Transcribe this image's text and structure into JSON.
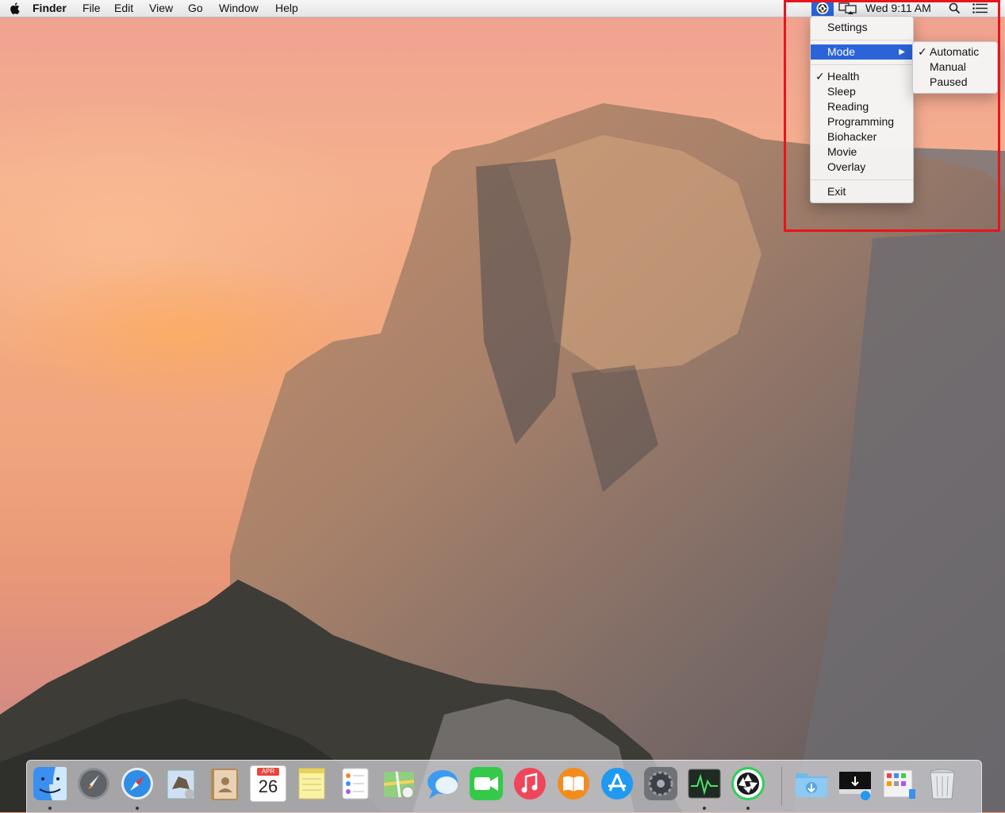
{
  "menubar": {
    "app_name": "Finder",
    "menus": [
      "File",
      "Edit",
      "View",
      "Go",
      "Window",
      "Help"
    ],
    "clock": "Wed 9:11 AM"
  },
  "app_menu": {
    "settings": "Settings",
    "mode": "Mode",
    "presets": [
      "Health",
      "Sleep",
      "Reading",
      "Programming",
      "Biohacker",
      "Movie",
      "Overlay"
    ],
    "checked_preset": "Health",
    "exit": "Exit"
  },
  "mode_submenu": {
    "options": [
      "Automatic",
      "Manual",
      "Paused"
    ],
    "checked_option": "Automatic"
  },
  "checkmark": "✓",
  "submenu_arrow": "▶",
  "dock": {
    "calendar_month": "APR",
    "calendar_day": "26",
    "apps": [
      "finder-icon",
      "launchpad-icon",
      "safari-icon",
      "mail-icon",
      "contacts-icon",
      "calendar-icon",
      "notes-icon",
      "reminders-icon",
      "maps-icon",
      "messages-icon",
      "facetime-icon",
      "itunes-icon",
      "ibooks-icon",
      "app-store-icon",
      "system-preferences-icon",
      "activity-monitor-icon",
      "iris-icon"
    ],
    "right_items": [
      "downloads-folder-icon",
      "downloads-stack-icon",
      "applications-stack-icon",
      "trash-icon"
    ]
  },
  "colors": {
    "highlight": "#2b63d9",
    "annotation_box": "#e8141b"
  }
}
